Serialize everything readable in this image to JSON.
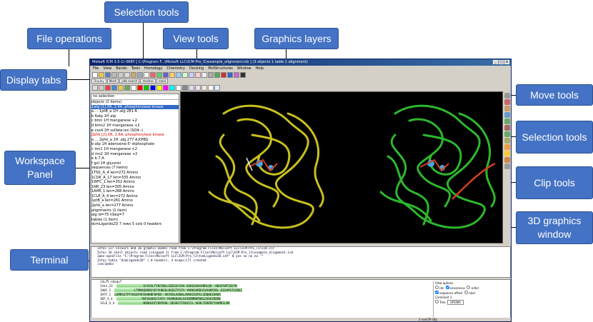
{
  "callouts": {
    "selection_tools_top": "Selection tools",
    "file_operations": "File operations",
    "view_tools": "View tools",
    "graphics_layers": "Graphics layers",
    "display_tabs": "Display tabs",
    "move_tools": "Move tools",
    "selection_tools_right": "Selection tools",
    "workspace_panel": "Workspace Panel",
    "clip_tools": "Clip tools",
    "graphics_window": "3D graphics window",
    "terminal": "Terminal"
  },
  "window": {
    "title": "Molsoft ICM 3.5-1r 0KBY [ C:\\Program F...\\Molsoft LLC\\ICM-Pro_l1\\example_alignment.icb ] (3 objects 1 table 1 alignment)",
    "menu": [
      "File",
      "View",
      "Bands",
      "Tools",
      "Homology",
      "Chemistry",
      "Docking",
      "MolStructures",
      "Window",
      "Help"
    ],
    "tabs": [
      "Display",
      "Mesh",
      "pdb search",
      "meshes",
      "more"
    ]
  },
  "workspace": {
    "header": "no selection",
    "items": [
      "objects    (2 items)",
      "  1atg   [1].XR, 2.4A, phosphorylase kinase",
      "    a  ... 1ptB_a    1H  .alg    281 A",
      "    b  6atp       1H  atp",
      "    c  bmn        1H  manganese +2",
      "    d  bmn2       1H  manganese +2",
      "    e  csx4       1H  sulfate-ion (SO4--)",
      "  2phk   [2].XR, 2.6A, phosphorylase kinase",
      "    a  ... 2phk_a     1H  .alg    277 A,KPBG",
      "    b  atp        1H  adenosine-5'-diphosphate",
      "    c  mn1        1H  manganese +2",
      "    d  mn2        1H  manganese +2",
      "    e  b          7 A",
      "    f  gol        1H  glycerol",
      "sequences    (7 items)",
      "  1TN1_A_4    len=272 Amino",
      "  1CDK_A_17   len=335 Amino",
      "  1WFC_1      len=352 Amino",
      "  1NR_23      len=305 Amino",
      "  1AHK_1      len=288 Amino",
      "  1CLE_A_4    len=272 Amino",
      "  1ptB_a      len=281 Amino",
      "  2phk_a      len=277 Amino",
      "alignments    (1 item)",
      "  alg    id=75 nSeq=7",
      "tables    (1 item)",
      "  dcmLigands2D    7 rows 5 cols 0 headers"
    ]
  },
  "terminal": {
    "lines": [
      "Info> 127 colours and 16 graphic modes read from C:\\Program Files\\Molsoft LLC\\ICM-Pro_l1\\icm.clr",
      "Info> 16 shell objects read (skipped 1) from C:\\Program Files\\Molsoft LLC\\ICM-Pro_l1\\example_alignment.icb",
      "2pko openFile \"C:\\Program Files\\Molsoft LLC\\ICM-Pro_l1\\tcmLigands2D.sdf\" 0 yes no no no \"\"",
      "Info> table \"dcmLigands2D\" ( 0 headers, 4 mcaps)[7] created",
      "icm/2pkb>"
    ]
  },
  "alignment": {
    "rows": [
      {
        "name": "id=75 nSeq=7",
        "seq": ""
      },
      {
        "name": "1tkn_23",
        "seq": "...............GCVSSLTYKFGNLLGEEGSFGAV-AGKGGAAAVKRLQK--HDGVFWFIEEYN"
      },
      {
        "name": "1AHC_1",
        "seq": "...........LTMHAQSKDGYEYYHKGELDGEGTFSTV-YKRKSARDGIVAVKRIRL-EEGVPSTAIREI"
      },
      {
        "name": "1HTF_1",
        "seq": "LEMRSSTPTYKGEFRFEVHKNFHPEN--VKYRSLAGNALAVKKCESPCLIDQHEIHAER"
      },
      {
        "name": "1NT_A_4",
        "seq": "..............YKFGEAKGCFAFV-YKARKDGKLVAIKRMRKPQKLEVAAIRERE"
      },
      {
        "name": "1CLE_A_4",
        "seq": "..............NSNHLDIYEKPGRL-QEGKGTFGKVIIL-AEHLTERERFYAAMKILRK"
      }
    ],
    "options": {
      "title": "View options",
      "ids": "ids",
      "consensus": "consensus",
      "order": "order",
      "sequence_offset": "sequence offset",
      "ruler": "ruler",
      "comment": "Comment",
      "comment_value": "1",
      "tree": "Tree",
      "color_scheme": "UPGMA",
      "status": "2 nonCM Obj"
    }
  },
  "colors": {
    "callout_bg": "#4472c4",
    "protein_left": "#c8c020",
    "protein_right": "#2db82d",
    "ligand": "#d04020",
    "selection_highlight": "#316ac5"
  }
}
